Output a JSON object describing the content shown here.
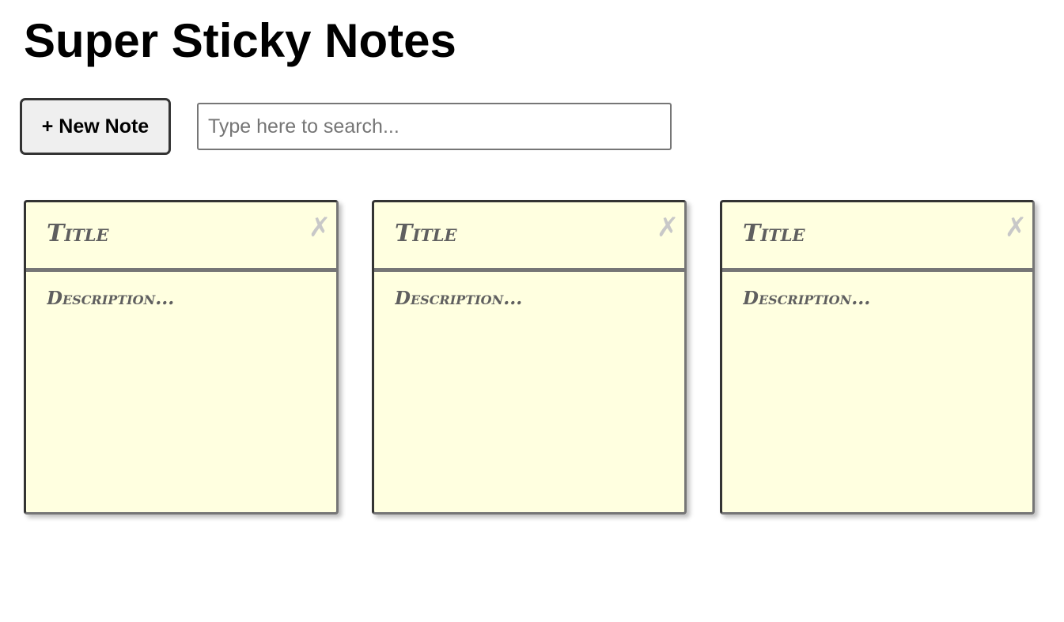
{
  "app": {
    "title": "Super Sticky Notes"
  },
  "toolbar": {
    "new_note_label": "+ New Note",
    "search_placeholder": "Type here to search..."
  },
  "notes": [
    {
      "title_placeholder": "Title",
      "description_placeholder": "Description...",
      "close_glyph": "✗"
    },
    {
      "title_placeholder": "Title",
      "description_placeholder": "Description...",
      "close_glyph": "✗"
    },
    {
      "title_placeholder": "Title",
      "description_placeholder": "Description...",
      "close_glyph": "✗"
    }
  ],
  "colors": {
    "note_background": "#ffffe0",
    "note_border": "#767676",
    "note_text": "#5f5f5f",
    "close_icon": "#c8c8c8"
  },
  "icons": {
    "close": "close-icon"
  }
}
